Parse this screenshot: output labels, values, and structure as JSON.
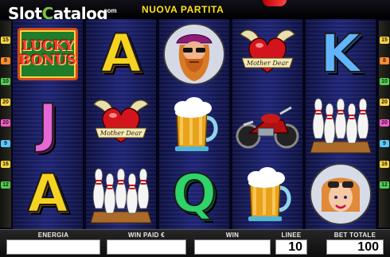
{
  "header": {
    "logo_main_1": "Slot",
    "logo_o": "C",
    "logo_main_2": "atalog",
    "logo_suffix": ".com",
    "new_game_label": "NUOVA PARTITA"
  },
  "reels": [
    [
      {
        "type": "bonus",
        "line1": "LUCKY",
        "line2": "BONUS"
      },
      {
        "type": "letter",
        "value": "J",
        "color": "#e667d6"
      },
      {
        "type": "letter",
        "value": "A",
        "color": "#f6d320"
      }
    ],
    [
      {
        "type": "letter",
        "value": "A",
        "color": "#f6d320"
      },
      {
        "type": "heart",
        "banner": "Mother Dear"
      },
      {
        "type": "bowling",
        "icon": "bowling-pins-icon"
      }
    ],
    [
      {
        "type": "biker",
        "icon": "biker-icon"
      },
      {
        "type": "beer",
        "icon": "beer-mug-icon"
      },
      {
        "type": "letter",
        "value": "Q",
        "color": "#2ed36a"
      }
    ],
    [
      {
        "type": "heart",
        "banner": "Mother Dear"
      },
      {
        "type": "motorcycle",
        "icon": "motorcycle-icon"
      },
      {
        "type": "beer",
        "icon": "beer-mug-icon"
      }
    ],
    [
      {
        "type": "letter",
        "value": "K",
        "color": "#62b4ff"
      },
      {
        "type": "bowling",
        "icon": "bowling-pins-icon"
      },
      {
        "type": "girl",
        "icon": "biker-girl-icon"
      }
    ]
  ],
  "side_markers_left": [
    "15",
    "8",
    "10",
    "20",
    "20",
    "9",
    "16",
    "12"
  ],
  "side_markers_right": [
    "15",
    "8",
    "10",
    "20",
    "20",
    "9",
    "16",
    "12"
  ],
  "panel": {
    "energy_label": "ENERGIA",
    "energy_value": "",
    "win_paid_label": "WIN PAID €",
    "win_paid_value": "",
    "win_label": "WIN",
    "win_value": "",
    "lines_label": "LINEE",
    "lines_value": "10",
    "bet_total_label": "BET TOTALE",
    "bet_total_value": "100"
  }
}
